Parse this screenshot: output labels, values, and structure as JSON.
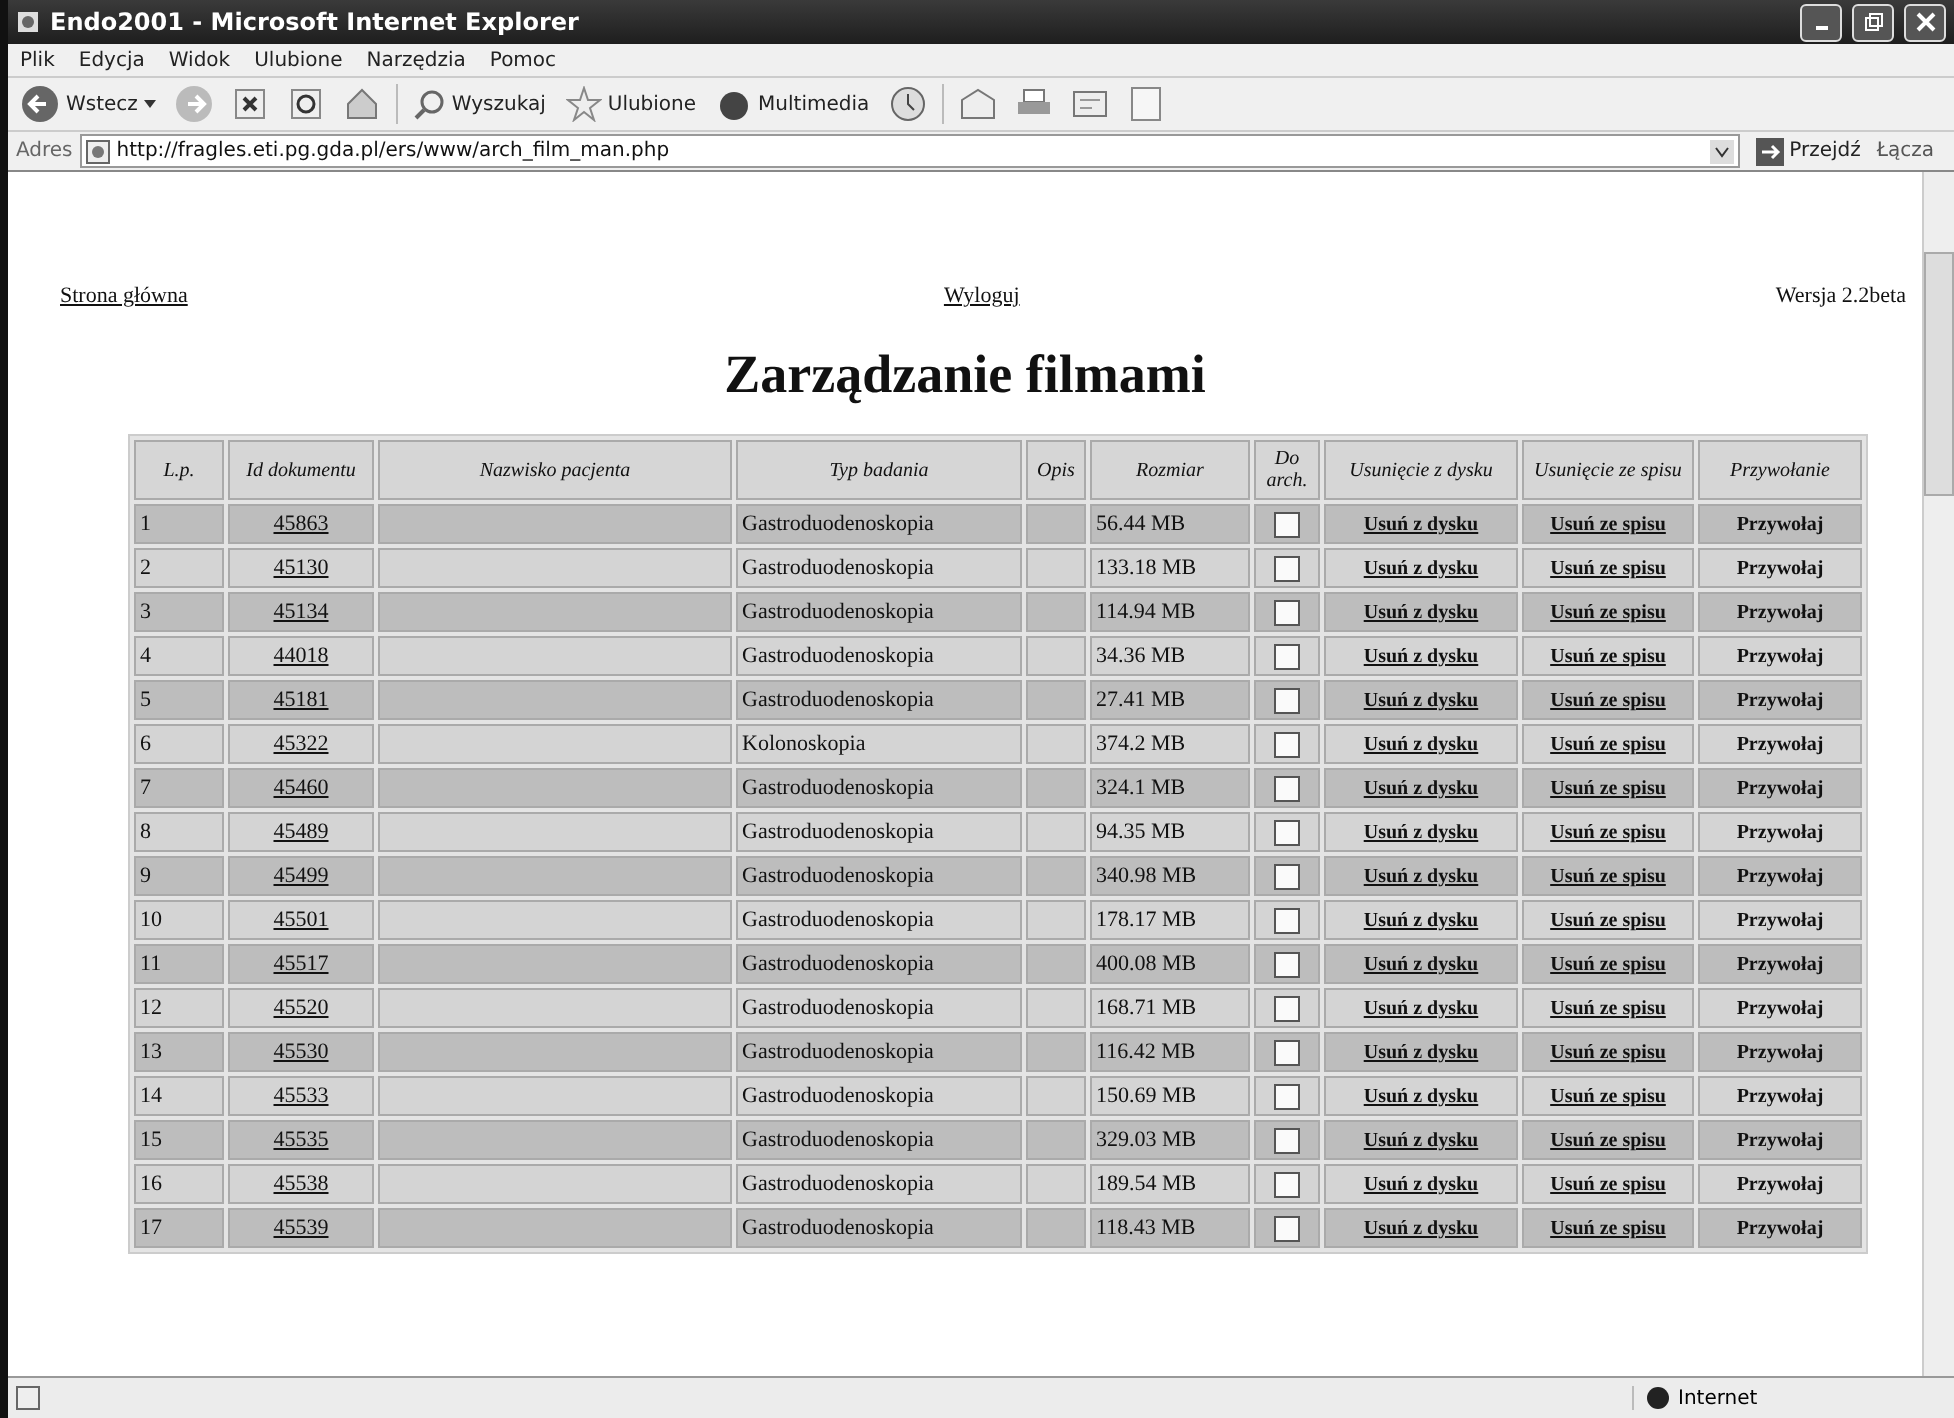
{
  "window": {
    "title": "Endo2001 - Microsoft Internet Explorer"
  },
  "menu": [
    "Plik",
    "Edycja",
    "Widok",
    "Ulubione",
    "Narzędzia",
    "Pomoc"
  ],
  "toolbar": {
    "back": "Wstecz",
    "search": "Wyszukaj",
    "favorites": "Ulubione",
    "media": "Multimedia"
  },
  "address_bar": {
    "label": "Adres",
    "url": "http://fragles.eti.pg.gda.pl/ers/www/arch_film_man.php",
    "go": "Przejdź",
    "links": "Łącza"
  },
  "top_links": {
    "home": "Strona główna",
    "logout": "Wyloguj",
    "version": "Wersja 2.2beta"
  },
  "heading": "Zarządzanie filmami",
  "table": {
    "columns": [
      "L.p.",
      "Id dokumentu",
      "Nazwisko pacjenta",
      "Typ badania",
      "Opis",
      "Rozmiar",
      "Do arch.",
      "Usunięcie z dysku",
      "Usunięcie ze spisu",
      "Przywołanie"
    ],
    "rows": [
      {
        "lp": "1",
        "id": "45863",
        "type": "Gastroduodenoskopia",
        "size": "56.44 MB",
        "archive": false,
        "delete_disk": "Usuń z dysku",
        "delete_list": "Usuń ze spisu",
        "recall": "Przywołaj"
      },
      {
        "lp": "2",
        "id": "45130",
        "type": "Gastroduodenoskopia",
        "size": "133.18 MB",
        "archive": false,
        "delete_disk": "Usuń z dysku",
        "delete_list": "Usuń ze spisu",
        "recall": "Przywołaj"
      },
      {
        "lp": "3",
        "id": "45134",
        "type": "Gastroduodenoskopia",
        "size": "114.94 MB",
        "archive": false,
        "delete_disk": "Usuń z dysku",
        "delete_list": "Usuń ze spisu",
        "recall": "Przywołaj"
      },
      {
        "lp": "4",
        "id": "44018",
        "type": "Gastroduodenoskopia",
        "size": "34.36 MB",
        "archive": false,
        "delete_disk": "Usuń z dysku",
        "delete_list": "Usuń ze spisu",
        "recall": "Przywołaj"
      },
      {
        "lp": "5",
        "id": "45181",
        "type": "Gastroduodenoskopia",
        "size": "27.41 MB",
        "archive": false,
        "delete_disk": "Usuń z dysku",
        "delete_list": "Usuń ze spisu",
        "recall": "Przywołaj"
      },
      {
        "lp": "6",
        "id": "45322",
        "type": "Kolonoskopia",
        "size": "374.2 MB",
        "archive": false,
        "delete_disk": "Usuń z dysku",
        "delete_list": "Usuń ze spisu",
        "recall": "Przywołaj"
      },
      {
        "lp": "7",
        "id": "45460",
        "type": "Gastroduodenoskopia",
        "size": "324.1 MB",
        "archive": false,
        "delete_disk": "Usuń z dysku",
        "delete_list": "Usuń ze spisu",
        "recall": "Przywołaj"
      },
      {
        "lp": "8",
        "id": "45489",
        "type": "Gastroduodenoskopia",
        "size": "94.35 MB",
        "archive": false,
        "delete_disk": "Usuń z dysku",
        "delete_list": "Usuń ze spisu",
        "recall": "Przywołaj"
      },
      {
        "lp": "9",
        "id": "45499",
        "type": "Gastroduodenoskopia",
        "size": "340.98 MB",
        "archive": false,
        "delete_disk": "Usuń z dysku",
        "delete_list": "Usuń ze spisu",
        "recall": "Przywołaj"
      },
      {
        "lp": "10",
        "id": "45501",
        "type": "Gastroduodenoskopia",
        "size": "178.17 MB",
        "archive": false,
        "delete_disk": "Usuń z dysku",
        "delete_list": "Usuń ze spisu",
        "recall": "Przywołaj"
      },
      {
        "lp": "11",
        "id": "45517",
        "type": "Gastroduodenoskopia",
        "size": "400.08 MB",
        "archive": false,
        "delete_disk": "Usuń z dysku",
        "delete_list": "Usuń ze spisu",
        "recall": "Przywołaj"
      },
      {
        "lp": "12",
        "id": "45520",
        "type": "Gastroduodenoskopia",
        "size": "168.71 MB",
        "archive": false,
        "delete_disk": "Usuń z dysku",
        "delete_list": "Usuń ze spisu",
        "recall": "Przywołaj"
      },
      {
        "lp": "13",
        "id": "45530",
        "type": "Gastroduodenoskopia",
        "size": "116.42 MB",
        "archive": false,
        "delete_disk": "Usuń z dysku",
        "delete_list": "Usuń ze spisu",
        "recall": "Przywołaj"
      },
      {
        "lp": "14",
        "id": "45533",
        "type": "Gastroduodenoskopia",
        "size": "150.69 MB",
        "archive": false,
        "delete_disk": "Usuń z dysku",
        "delete_list": "Usuń ze spisu",
        "recall": "Przywołaj"
      },
      {
        "lp": "15",
        "id": "45535",
        "type": "Gastroduodenoskopia",
        "size": "329.03 MB",
        "archive": false,
        "delete_disk": "Usuń z dysku",
        "delete_list": "Usuń ze spisu",
        "recall": "Przywołaj"
      },
      {
        "lp": "16",
        "id": "45538",
        "type": "Gastroduodenoskopia",
        "size": "189.54 MB",
        "archive": false,
        "delete_disk": "Usuń z dysku",
        "delete_list": "Usuń ze spisu",
        "recall": "Przywołaj"
      },
      {
        "lp": "17",
        "id": "45539",
        "type": "Gastroduodenoskopia",
        "size": "118.43 MB",
        "archive": false,
        "delete_disk": "Usuń z dysku",
        "delete_list": "Usuń ze spisu",
        "recall": "Przywołaj"
      }
    ]
  },
  "status_bar": {
    "zone": "Internet"
  }
}
